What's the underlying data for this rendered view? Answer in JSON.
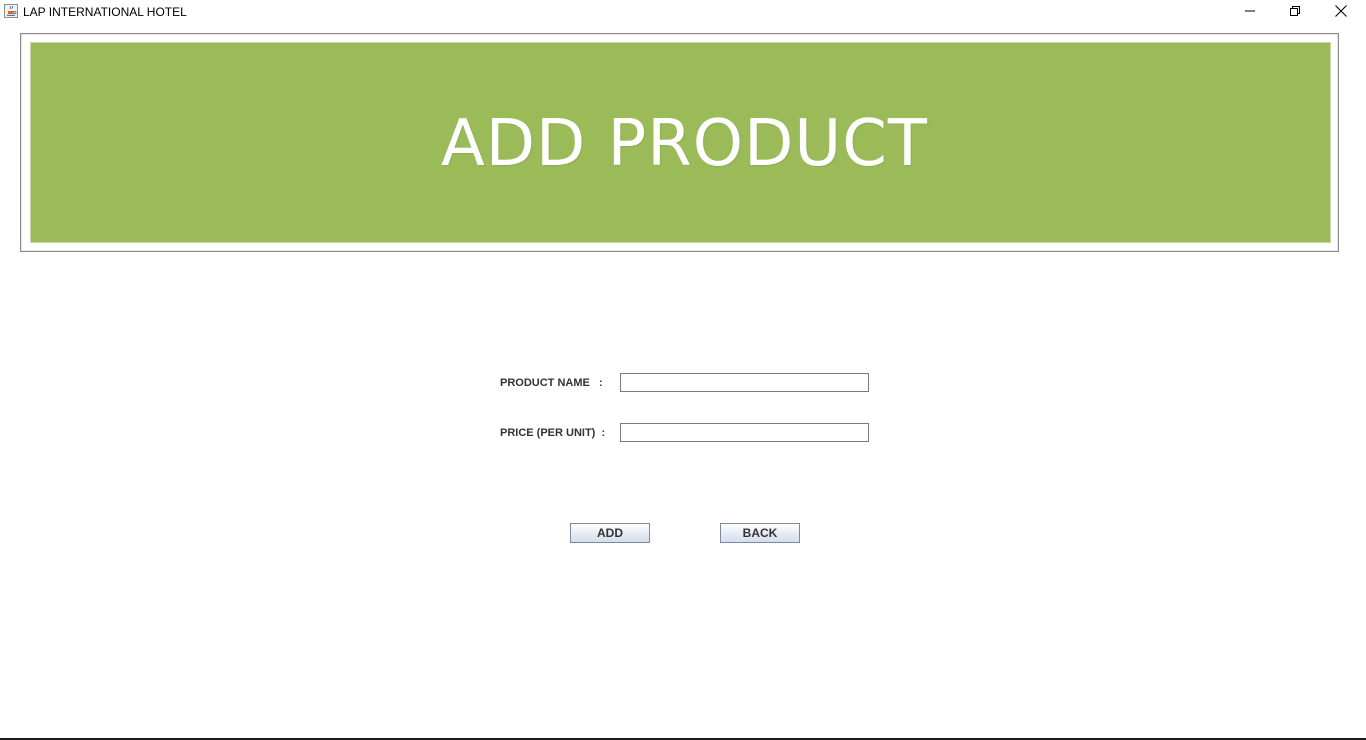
{
  "window": {
    "title": "LAP INTERNATIONAL HOTEL",
    "app_icon": "java-coffee-cup-icon",
    "controls": {
      "minimize_icon": "minimize-icon",
      "maximize_icon": "restore-icon",
      "close_icon": "close-icon"
    }
  },
  "banner": {
    "title": "ADD PRODUCT",
    "background_color": "#9bbb59",
    "text_color": "#ffffff"
  },
  "form": {
    "product_name": {
      "label": "PRODUCT NAME   :",
      "value": ""
    },
    "price": {
      "label": "PRICE (PER UNIT)  :",
      "value": ""
    }
  },
  "buttons": {
    "add_label": "ADD",
    "back_label": "BACK"
  }
}
